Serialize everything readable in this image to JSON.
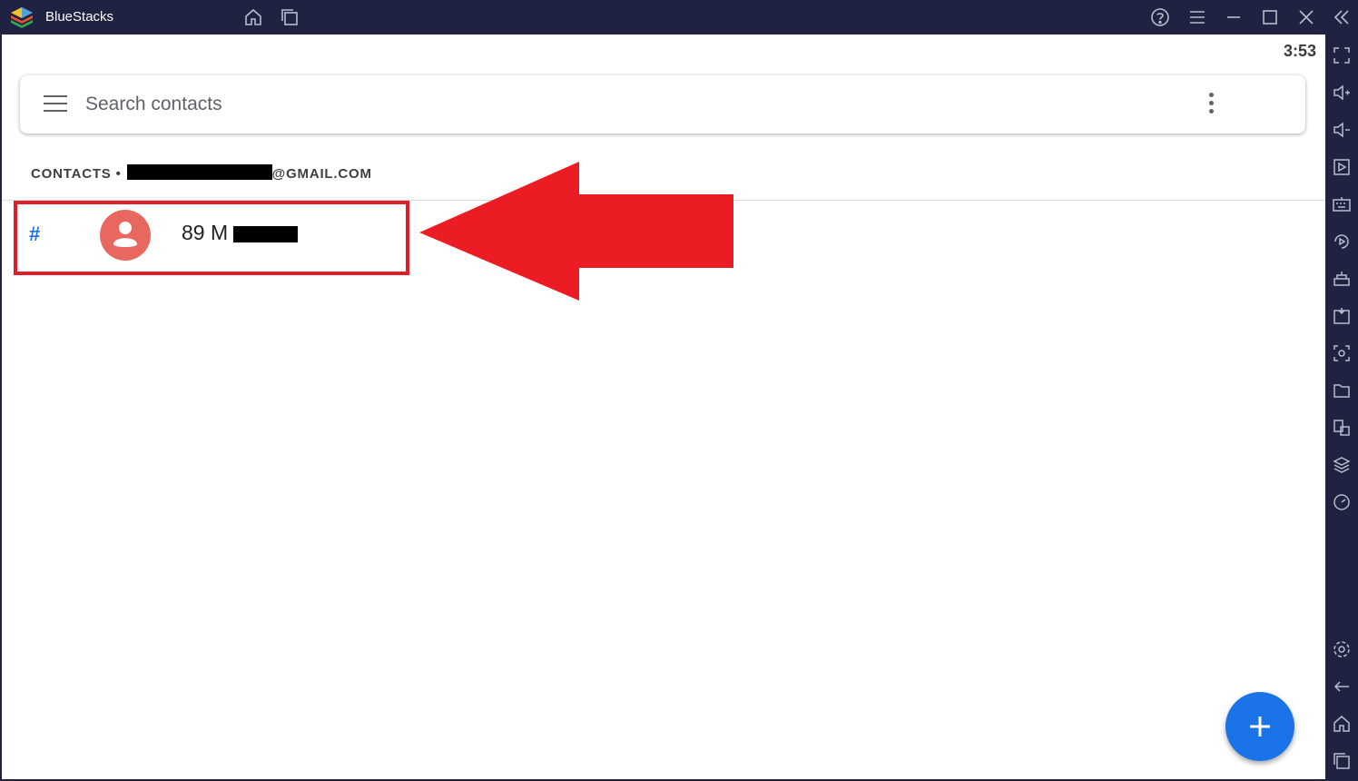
{
  "window": {
    "title": "BlueStacks",
    "titlebar_icons": [
      "home-icon",
      "multi-instance-icon",
      "help-icon",
      "menu-icon",
      "minimize-icon",
      "maximize-icon",
      "close-icon",
      "collapse-sidebar-icon"
    ]
  },
  "status_bar": {
    "time": "3:53"
  },
  "search": {
    "placeholder": "Search contacts"
  },
  "account": {
    "prefix": "CONTACTS •",
    "suffix": "@GMAIL.COM"
  },
  "contacts": [
    {
      "section": "#",
      "name_visible": "89 M"
    }
  ],
  "sidebar_icons": [
    "fullscreen-icon",
    "volume-up-icon",
    "volume-down-icon",
    "screen-record-icon",
    "keyboard-icon",
    "macro-icon",
    "rotate-icon",
    "install-apk-icon",
    "screenshot-icon",
    "folder-icon",
    "multi-instance-icon",
    "layers-icon",
    "performance-icon",
    "settings-icon",
    "back-icon",
    "home-icon",
    "recent-apps-icon"
  ],
  "colors": {
    "titlebar": "#1f2240",
    "accent_blue": "#1a73e8",
    "avatar": "#e8675e",
    "annotation_red": "#e11d27"
  }
}
